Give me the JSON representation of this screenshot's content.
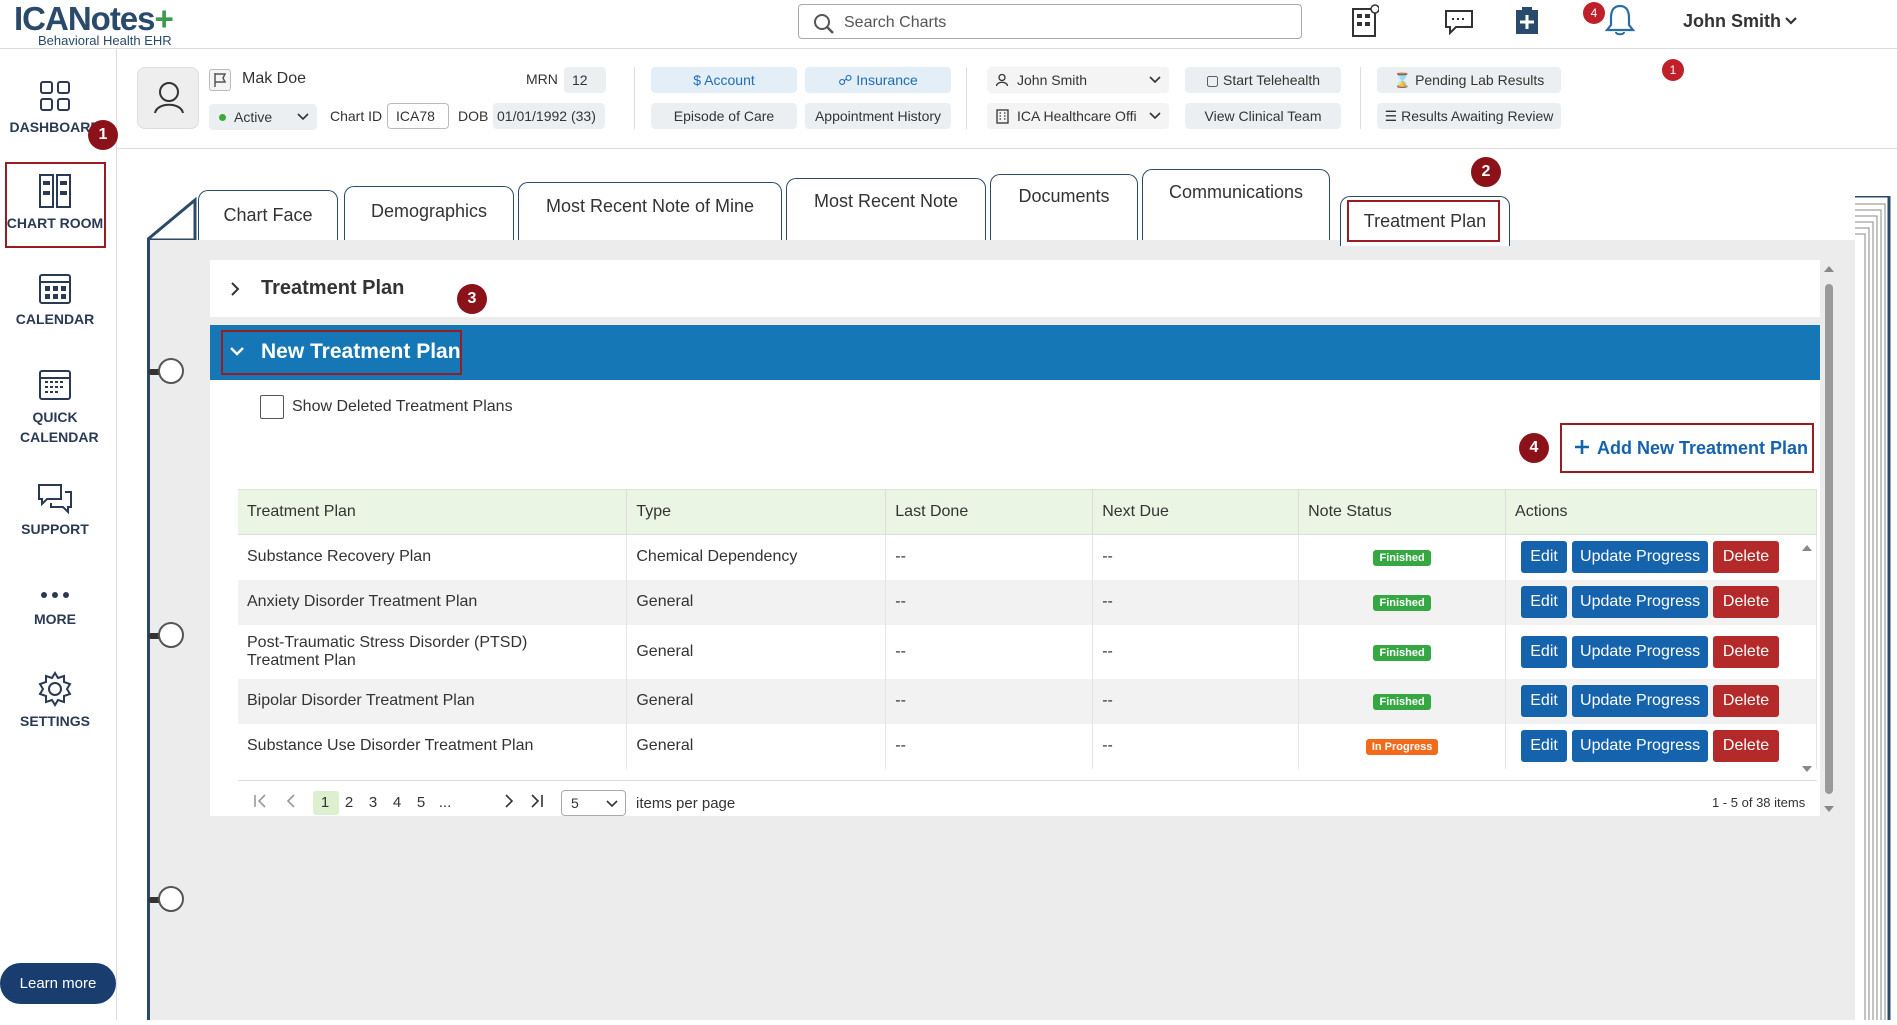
{
  "app": {
    "logo": "ICANotes",
    "logo_sub": "Behavioral Health EHR"
  },
  "topbar": {
    "search_placeholder": "Search Charts",
    "user": "John Smith",
    "notifications_count": "4"
  },
  "sidebar": {
    "items": [
      {
        "label": "DASHBOARD",
        "badge": "1"
      },
      {
        "label": "CHART ROOM"
      },
      {
        "label": "CALENDAR"
      },
      {
        "label": "QUICK CALENDAR"
      },
      {
        "label": "SUPPORT"
      },
      {
        "label": "MORE"
      },
      {
        "label": "SETTINGS"
      }
    ],
    "learn_more": "Learn more"
  },
  "patient": {
    "name": "Mak Doe",
    "status": "Active",
    "mrn_label": "MRN",
    "mrn": "12",
    "chart_id_label": "Chart ID",
    "chart_id": "ICA78",
    "dob_label": "DOB",
    "dob": "01/01/1992 (33)",
    "account": "Account",
    "insurance": "Insurance",
    "episode": "Episode of Care",
    "appointment_history": "Appointment History",
    "provider": "John Smith",
    "facility": "ICA Healthcare Offi",
    "start_telehealth": "Start Telehealth",
    "view_clinical_team": "View Clinical Team",
    "pending_lab": "Pending Lab Results",
    "pending_lab_badge": "1",
    "results_review": "Results Awaiting Review"
  },
  "tabs": [
    "Chart Face",
    "Demographics",
    "Most Recent Note of Mine",
    "Most Recent Note",
    "Documents",
    "Communications",
    "Treatment Plan"
  ],
  "badges": {
    "b2": "2",
    "b3": "3",
    "b4": "4"
  },
  "sections": {
    "treatment_plan": "Treatment Plan",
    "new_treatment_plan": "New Treatment Plan",
    "show_deleted": "Show Deleted Treatment Plans",
    "add_new": "Add New Treatment Plan"
  },
  "table": {
    "columns": [
      "Treatment Plan",
      "Type",
      "Last Done",
      "Next Due",
      "Note Status",
      "Actions"
    ],
    "rows": [
      {
        "plan": "Substance Recovery Plan",
        "type": "Chemical Dependency",
        "last": "--",
        "next": "--",
        "status": "Finished"
      },
      {
        "plan": "Anxiety Disorder Treatment Plan",
        "type": "General",
        "last": "--",
        "next": "--",
        "status": "Finished"
      },
      {
        "plan": "Post-Traumatic Stress Disorder (PTSD) Treatment Plan",
        "type": "General",
        "last": "--",
        "next": "--",
        "status": "Finished"
      },
      {
        "plan": "Bipolar Disorder Treatment Plan",
        "type": "General",
        "last": "--",
        "next": "--",
        "status": "Finished"
      },
      {
        "plan": "Substance Use Disorder Treatment Plan",
        "type": "General",
        "last": "--",
        "next": "--",
        "status": "In Progress"
      }
    ],
    "actions": {
      "edit": "Edit",
      "update": "Update Progress",
      "delete": "Delete"
    }
  },
  "pager": {
    "pages": [
      "1",
      "2",
      "3",
      "4",
      "5",
      "..."
    ],
    "per_page": "5",
    "per_page_label": "items per page",
    "summary": "1 - 5 of 38 items"
  },
  "colors": {
    "brand": "#2a4a6b",
    "section_bar": "#1577b5",
    "button": "#1562ad",
    "delete": "#b42a2a",
    "annotation": "#8c1219"
  }
}
